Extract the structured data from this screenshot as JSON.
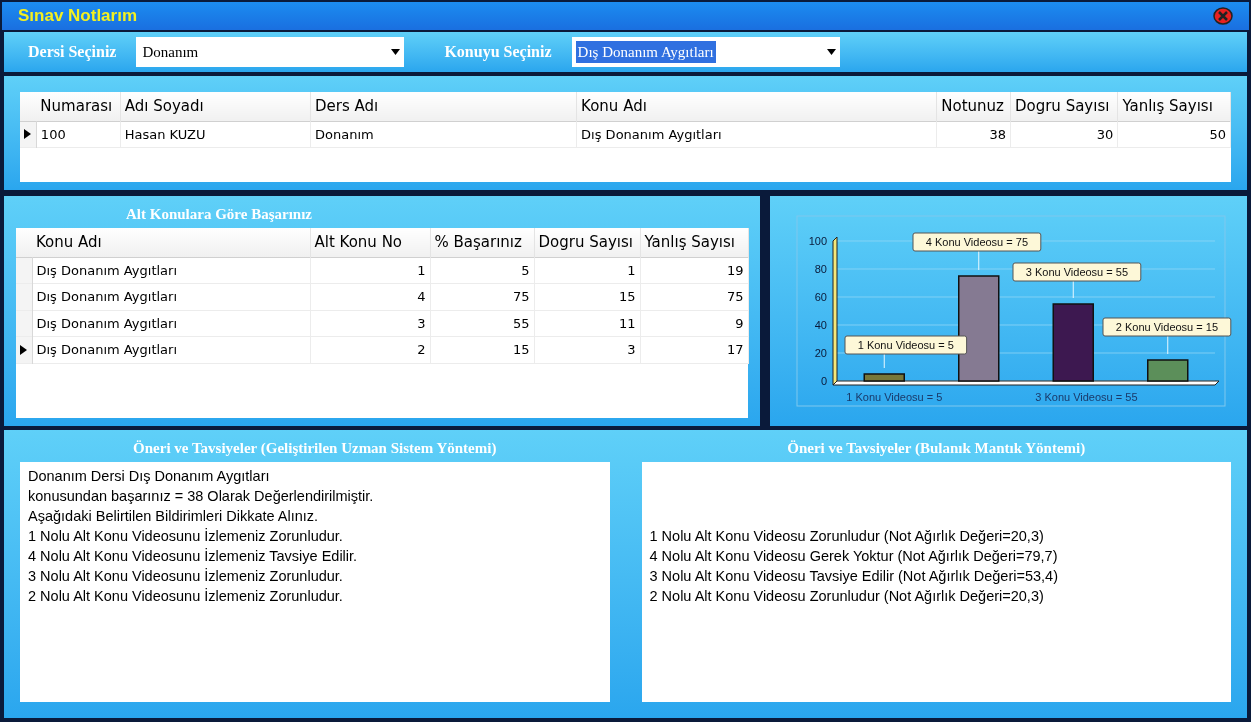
{
  "window": {
    "title": "Sınav Notlarım"
  },
  "filters": [
    {
      "label": "Dersi Seçiniz",
      "value": "Donanım",
      "highlighted": false
    },
    {
      "label": "Konuyu Seçiniz",
      "value": "Dış Donanım Aygıtları",
      "highlighted": true
    }
  ],
  "results_table": {
    "columns": [
      "Numarası",
      "Adı Soyadı",
      "Ders Adı",
      "Konu Adı",
      "Notunuz",
      "Dogru Sayısı",
      "Yanlış Sayısı"
    ],
    "rows": [
      {
        "selected": true,
        "cells": [
          "100",
          "Hasan KUZU",
          "Donanım",
          "Dış Donanım Aygıtları",
          "38",
          "30",
          "50"
        ]
      }
    ]
  },
  "subtopics": {
    "title": "Alt Konulara Göre Başarınız",
    "columns": [
      "Konu Adı",
      "Alt Konu No",
      "% Başarınız",
      "Dogru Sayısı",
      "Yanlış Sayısı"
    ],
    "rows": [
      {
        "selected": false,
        "cells": [
          "Dış Donanım Aygıtları",
          "1",
          "5",
          "1",
          "19"
        ]
      },
      {
        "selected": false,
        "cells": [
          "Dış Donanım Aygıtları",
          "4",
          "75",
          "15",
          "75"
        ]
      },
      {
        "selected": false,
        "cells": [
          "Dış Donanım Aygıtları",
          "3",
          "55",
          "11",
          "9"
        ]
      },
      {
        "selected": true,
        "cells": [
          "Dış Donanım Aygıtları",
          "2",
          "15",
          "3",
          "17"
        ]
      }
    ]
  },
  "chart_data": {
    "type": "bar",
    "categories": [
      "1 Konu Videosu = 5",
      "4 Konu Videosu = 75",
      "3 Konu Videosu = 55",
      "2 Konu Videosu = 15"
    ],
    "values": [
      5,
      75,
      55,
      15
    ],
    "colors": [
      "#77773a",
      "#857a92",
      "#3d1850",
      "#5c8f5a"
    ],
    "ylim": [
      0,
      100
    ],
    "yticks": [
      0,
      20,
      40,
      60,
      80,
      100
    ],
    "grid": true
  },
  "advice_panels": [
    {
      "title": "Öneri ve Tavsiyeler (Geliştirilen Uzman Sistem Yöntemi)",
      "kind": "expert",
      "lines": [
        "Donanım Dersi Dış Donanım Aygıtları",
        "konusundan başarınız = 38 Olarak Değerlendirilmiştir.",
        "Aşağıdaki Belirtilen Bildirimleri Dikkate Alınız.",
        "1 Nolu Alt Konu Videosunu İzlemeniz Zorunludur.",
        "4 Nolu Alt Konu Videosunu İzlemeniz Tavsiye Edilir.",
        "3 Nolu Alt Konu Videosunu İzlemeniz Zorunludur.",
        "2 Nolu Alt Konu Videosunu İzlemeniz Zorunludur."
      ]
    },
    {
      "title": "Öneri ve Tavsiyeler (Bulanık Mantık Yöntemi)",
      "kind": "fuzzy",
      "lines": [
        "1 Nolu Alt Konu Videosu Zorunludur (Not Ağırlık Değeri=20,3)",
        "4 Nolu Alt Konu Videosu Gerek Yoktur (Not Ağırlık Değeri=79,7)",
        "3 Nolu Alt Konu Videosu Tavsiye Edilir (Not Ağırlık Değeri=53,4)",
        "2 Nolu Alt Konu Videosu Zorunludur (Not Ağırlık Değeri=20,3)"
      ]
    }
  ]
}
